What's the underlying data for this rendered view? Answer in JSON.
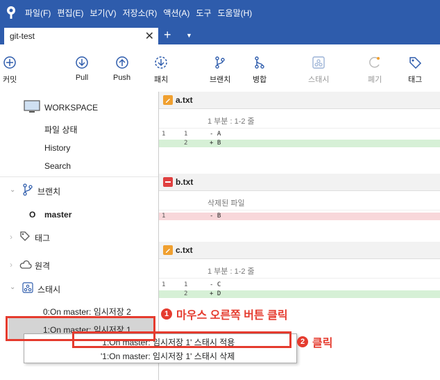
{
  "menubar": {
    "items": [
      "파일(F)",
      "편집(E)",
      "보기(V)",
      "저장소(R)",
      "액션(A)",
      "도구",
      "도움말(H)"
    ]
  },
  "tab": {
    "title": "git-test",
    "close": "✕",
    "add": "+",
    "dropdown": "▼"
  },
  "toolbar": {
    "commit": "커밋",
    "pull": "Pull",
    "push": "Push",
    "patch": "패치",
    "branch": "브랜치",
    "merge": "병합",
    "stash": "스태시",
    "discard": "폐기",
    "tag": "태그"
  },
  "sidebar": {
    "workspace": "WORKSPACE",
    "file_status": "파일 상태",
    "history": "History",
    "search": "Search",
    "branches": "브랜치",
    "master": "master",
    "tags": "태그",
    "remotes": "원격",
    "stashes": "스태시",
    "stash0": "0:On master: 임시저장 2",
    "stash1": "1:On master: 임시저장 1"
  },
  "diff": {
    "files": [
      {
        "name": "a.txt",
        "hunk": "1 부분 : 1-2 줄"
      },
      {
        "name": "b.txt",
        "hunk": "삭제된 파일"
      },
      {
        "name": "c.txt",
        "hunk": "1 부분 : 1-2 줄"
      }
    ],
    "a_lines": [
      {
        "ln1": "1",
        "ln2": "1",
        "code": "- A"
      },
      {
        "ln1": "",
        "ln2": "2",
        "code": "+ B"
      }
    ],
    "b_lines": [
      {
        "ln1": "1",
        "ln2": "",
        "code": "- B"
      }
    ],
    "c_lines": [
      {
        "ln1": "1",
        "ln2": "1",
        "code": "- C"
      },
      {
        "ln1": "",
        "ln2": "2",
        "code": "+ D"
      }
    ]
  },
  "context_menu": {
    "apply": "'1:On master: 임시저장 1' 스태시 적용",
    "delete": "'1:On master: 임시저장 1' 스태시 삭제"
  },
  "annotations": {
    "step1_num": "1",
    "step1": "마우스 오른쪽 버튼 클릭",
    "step2_num": "2",
    "step2": "클릭"
  },
  "colors": {
    "titlebar": "#2e5cac",
    "accent": "#2e5cac",
    "annotation": "#e53b2e",
    "added": "#d6f0d6",
    "removed": "#f8d7da",
    "modified_icon": "#f0a030",
    "deleted_icon": "#e04040"
  }
}
